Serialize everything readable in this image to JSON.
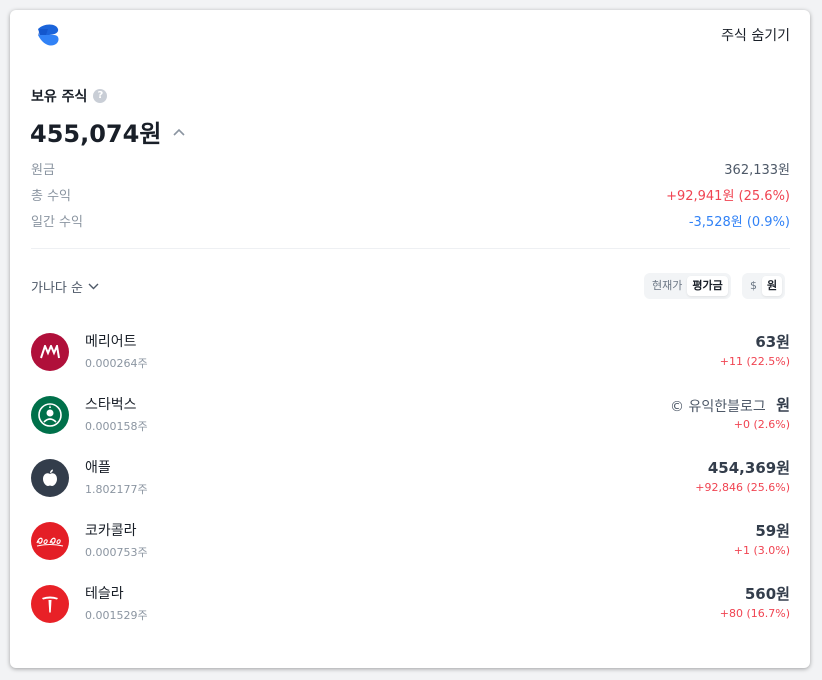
{
  "header": {
    "hide_label": "주식 숨기기"
  },
  "portfolio": {
    "title": "보유 주식",
    "help": "?",
    "total": "455,074원",
    "summary": [
      {
        "label": "원금",
        "value": "362,133원",
        "tone": "neutral"
      },
      {
        "label": "총 수익",
        "value": "+92,941원 (25.6%)",
        "tone": "up"
      },
      {
        "label": "일간 수익",
        "value": "-3,528원 (0.9%)",
        "tone": "down"
      }
    ]
  },
  "controls": {
    "sort_label": "가나다 순",
    "price_toggle": [
      "현재가",
      "평가금"
    ],
    "price_toggle_selected": "평가금",
    "currency_toggle": [
      "$",
      "원"
    ],
    "currency_toggle_selected": "원"
  },
  "stocks": [
    {
      "name": "메리어트",
      "qty": "0.000264주",
      "value": "63원",
      "change": "+11 (22.5%)",
      "logo": "marriott-logo",
      "logo_color": "#b0103a"
    },
    {
      "name": "스타벅스",
      "qty": "0.000158주",
      "value": "원",
      "change": "+0 (2.6%)",
      "logo": "starbucks-logo",
      "logo_color": "#00704a"
    },
    {
      "name": "애플",
      "qty": "1.802177주",
      "value": "454,369원",
      "change": "+92,846 (25.6%)",
      "logo": "apple-logo",
      "logo_color": "#333d4b"
    },
    {
      "name": "코카콜라",
      "qty": "0.000753주",
      "value": "59원",
      "change": "+1 (3.0%)",
      "logo": "cocacola-logo",
      "logo_color": "#e41e26"
    },
    {
      "name": "테슬라",
      "qty": "0.001529주",
      "value": "560원",
      "change": "+80 (16.7%)",
      "logo": "tesla-logo",
      "logo_color": "#e82127"
    }
  ],
  "watermark": "© 유익한블로그",
  "colors": {
    "up": "#f04452",
    "down": "#3182f6",
    "brand": "#3182f6"
  }
}
